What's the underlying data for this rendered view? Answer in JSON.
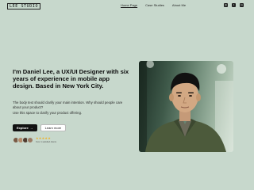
{
  "brand": "LEE STUDIO",
  "nav": {
    "links": [
      {
        "label": "Home Page",
        "active": true
      },
      {
        "label": "Case Studies",
        "active": false
      },
      {
        "label": "About Me",
        "active": false
      }
    ],
    "socials": [
      "instagram-icon",
      "twitter-icon",
      "linkedin-icon"
    ]
  },
  "hero": {
    "title": "I'm Daniel Lee, a UX/UI Designer with six years of experience in mobile app design. Based in New York City.",
    "body_1": "The body text should clarify your main intention. Why should people care about your product?",
    "body_2": "Use this space to clarify your product offering.",
    "primary_button": "Explore",
    "primary_button_icon": "arrow-right-icon",
    "secondary_button": "Learn more",
    "social_proof": {
      "avatar_count": 4,
      "stars": 5,
      "rating_text": "Over 1 satisfied clients"
    }
  },
  "colors": {
    "background": "#c7d8cc",
    "primary_button": "#111111",
    "star": "#f2b01e"
  }
}
